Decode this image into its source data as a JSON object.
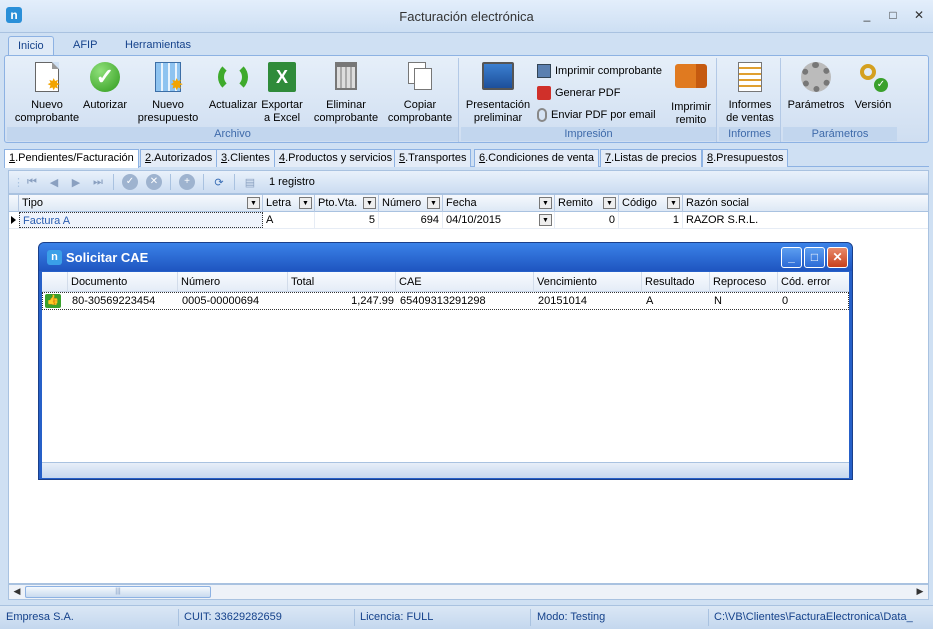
{
  "window": {
    "title": "Facturación electrónica",
    "logo": "n",
    "controls": [
      "_",
      "□",
      "✕"
    ]
  },
  "ribbon_tabs": [
    "Inicio",
    "AFIP",
    "Herramientas"
  ],
  "ribbon": {
    "archivo": {
      "label": "Archivo",
      "buttons": [
        {
          "label": "Nuevo\ncomprobante",
          "icon": "new-document-icon"
        },
        {
          "label": "Autorizar",
          "icon": "check-icon"
        },
        {
          "label": "Nuevo\npresupuesto",
          "icon": "calculator-icon"
        },
        {
          "label": "Actualizar",
          "icon": "refresh-icon"
        },
        {
          "label": "Exportar\na Excel",
          "icon": "excel-icon"
        },
        {
          "label": "Eliminar\ncomprobante",
          "icon": "trash-icon"
        },
        {
          "label": "Copiar\ncomprobante",
          "icon": "copy-icon"
        }
      ]
    },
    "impresion": {
      "label": "Impresión",
      "big": {
        "label": "Presentación\npreliminar",
        "icon": "monitor-icon"
      },
      "small": [
        {
          "label": "Imprimir comprobante",
          "icon": "printer-icon"
        },
        {
          "label": "Generar PDF",
          "icon": "pdf-icon"
        },
        {
          "label": "Enviar PDF por email",
          "icon": "attachment-icon"
        }
      ],
      "remito": {
        "label": "Imprimir\nremito",
        "icon": "truck-icon"
      }
    },
    "informes": {
      "label": "Informes",
      "button": {
        "label": "Informes\nde ventas",
        "icon": "report-icon"
      }
    },
    "parametros": {
      "label": "Parámetros",
      "buttons": [
        {
          "label": "Parámetros",
          "icon": "gear-icon"
        },
        {
          "label": "Versión",
          "icon": "key-icon"
        }
      ]
    }
  },
  "main_tabs": [
    {
      "num": "1",
      "label": ".Pendientes/Facturación"
    },
    {
      "num": "2",
      "label": ".Autorizados"
    },
    {
      "num": "3",
      "label": ".Clientes"
    },
    {
      "num": "4",
      "label": ".Productos y servicios"
    },
    {
      "num": "5",
      "label": ".Transportes"
    },
    {
      "num": "6",
      "label": ".Condiciones de venta"
    },
    {
      "num": "7",
      "label": ".Listas de precios"
    },
    {
      "num": "8",
      "label": ".Presupuestos"
    }
  ],
  "navbar": {
    "record_count": "1 registro"
  },
  "grid": {
    "columns": [
      "Tipo",
      "Letra",
      "Pto.Vta.",
      "Número",
      "Fecha",
      "Remito",
      "Código",
      "Razón social"
    ],
    "row": {
      "tipo": "Factura A",
      "letra": "A",
      "pto_vta": "5",
      "numero": "694",
      "fecha": "04/10/2015",
      "remito": "0",
      "codigo": "1",
      "razon_social": "RAZOR S.R.L."
    }
  },
  "dialog": {
    "title": "Solicitar CAE",
    "columns": [
      "Documento",
      "Número",
      "Total",
      "CAE",
      "Vencimiento",
      "Resultado",
      "Reproceso",
      "Cód. error"
    ],
    "row": {
      "documento": "80-30569223454",
      "numero": "0005-00000694",
      "total": "1,247.99",
      "cae": "65409313291298",
      "vencimiento": "20151014",
      "resultado": "A",
      "reproceso": "N",
      "cod_error": "0"
    }
  },
  "statusbar": {
    "empresa": "Empresa S.A.",
    "cuit": "CUIT: 33629282659",
    "licencia": "Licencia: FULL",
    "modo": "Modo: Testing",
    "path": "C:\\VB\\Clientes\\FacturaElectronica\\Data_"
  },
  "colors": {
    "ribbon_label": "#3e6aaa",
    "link_blue": "#15428b",
    "dialog_title": "#1f55c0"
  }
}
